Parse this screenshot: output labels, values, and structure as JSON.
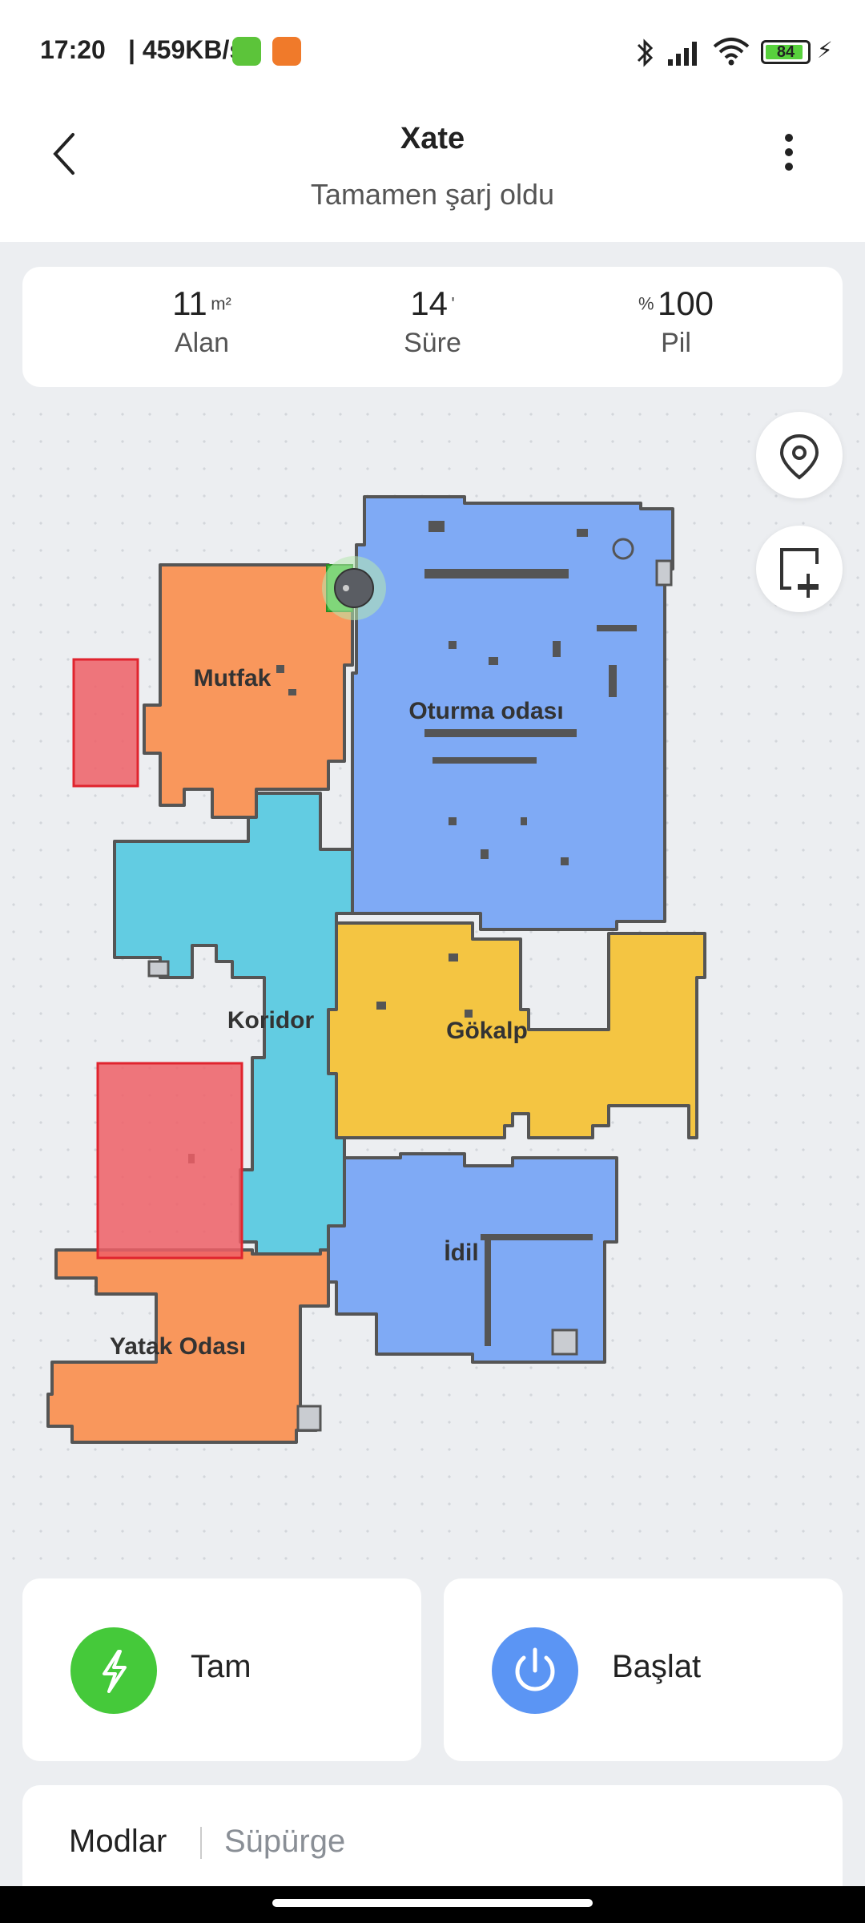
{
  "status_bar": {
    "time": "17:20",
    "speed": "| 459KB/s",
    "battery": "84"
  },
  "header": {
    "title": "Xate",
    "subtitle": "Tamamen şarj oldu"
  },
  "stats": {
    "area": {
      "value": "11",
      "unit": "m²",
      "label": "Alan"
    },
    "time": {
      "value": "14",
      "unit": "'",
      "label": "Süre"
    },
    "battery": {
      "value": "100",
      "unit": "%",
      "label": "Pil"
    }
  },
  "map": {
    "rooms": {
      "kitchen": "Mutfak",
      "living": "Oturma odası",
      "corridor": "Koridor",
      "gokalp": "Gökalp",
      "idil": "İdil",
      "bedroom": "Yatak Odası"
    },
    "colors": {
      "orange": "#f9975c",
      "blue": "#7faaf5",
      "cyan": "#62cce2",
      "yellow": "#f4c542",
      "no_go": "#ee5f66"
    }
  },
  "actions": {
    "mode": {
      "label": "Tam",
      "icon": "lightning-icon",
      "color": "#45c93a"
    },
    "start": {
      "label": "Başlat",
      "icon": "power-icon",
      "color": "#5b95f4"
    }
  },
  "modes": {
    "label": "Modlar",
    "value": "Süpürge"
  },
  "annotation_color": "#80d4fa"
}
